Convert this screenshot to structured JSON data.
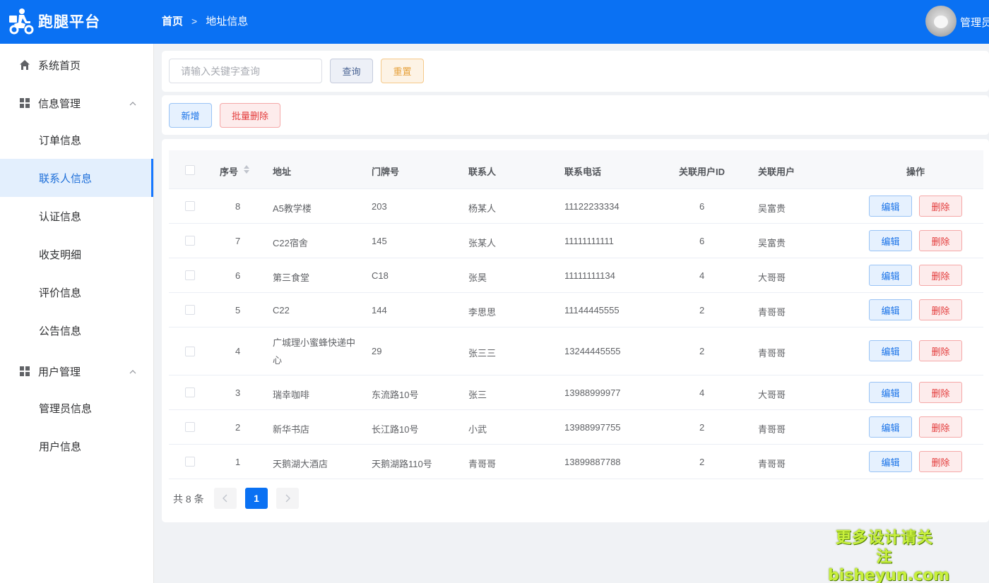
{
  "header": {
    "app_title": "跑腿平台",
    "breadcrumb_home": "首页",
    "breadcrumb_current": "地址信息",
    "user_name": "管理员",
    "color": "#0a71f3"
  },
  "sidebar": {
    "items": [
      {
        "label": "系统首页",
        "icon": "home-icon"
      },
      {
        "label": "信息管理",
        "icon": "grid-icon",
        "expanded": true
      },
      {
        "label": "订单信息"
      },
      {
        "label": "联系人信息",
        "active": true
      },
      {
        "label": "认证信息"
      },
      {
        "label": "收支明细"
      },
      {
        "label": "评价信息"
      },
      {
        "label": "公告信息"
      },
      {
        "label": "用户管理",
        "icon": "grid-icon",
        "expanded": true
      },
      {
        "label": "管理员信息"
      },
      {
        "label": "用户信息"
      }
    ]
  },
  "search": {
    "placeholder": "请输入关键字查询",
    "query_label": "查询",
    "reset_label": "重置"
  },
  "toolbar": {
    "add_label": "新增",
    "batch_delete_label": "批量删除"
  },
  "table": {
    "columns": [
      "序号",
      "地址",
      "门牌号",
      "联系人",
      "联系电话",
      "关联用户ID",
      "关联用户",
      "操作"
    ],
    "edit_label": "编辑",
    "delete_label": "删除",
    "rows": [
      {
        "id": "8",
        "address": "A5教学楼",
        "door": "203",
        "contact": "杨某人",
        "phone": "11122233334",
        "user_id": "6",
        "user": "吴富贵"
      },
      {
        "id": "7",
        "address": "C22宿舍",
        "door": "145",
        "contact": "张某人",
        "phone": "11111111111",
        "user_id": "6",
        "user": "吴富贵"
      },
      {
        "id": "6",
        "address": "第三食堂",
        "door": "C18",
        "contact": "张昊",
        "phone": "11111111134",
        "user_id": "4",
        "user": "大哥哥"
      },
      {
        "id": "5",
        "address": "C22",
        "door": "144",
        "contact": "李思思",
        "phone": "11144445555",
        "user_id": "2",
        "user": "青哥哥"
      },
      {
        "id": "4",
        "address": "广城理小蜜蜂快递中心",
        "door": "29",
        "contact": "张三三",
        "phone": "13244445555",
        "user_id": "2",
        "user": "青哥哥"
      },
      {
        "id": "3",
        "address": "瑞幸咖啡",
        "door": "东流路10号",
        "contact": "张三",
        "phone": "13988999977",
        "user_id": "4",
        "user": "大哥哥"
      },
      {
        "id": "2",
        "address": "新华书店",
        "door": "长江路10号",
        "contact": "小武",
        "phone": "13988997755",
        "user_id": "2",
        "user": "青哥哥"
      },
      {
        "id": "1",
        "address": "天鹅湖大酒店",
        "door": "天鹅湖路110号",
        "contact": "青哥哥",
        "phone": "13899887788",
        "user_id": "2",
        "user": "青哥哥"
      }
    ]
  },
  "pagination": {
    "total_text": "共 8 条",
    "current_page": "1",
    "prev_icon": "chevron-left-icon",
    "next_icon": "chevron-right-icon"
  },
  "watermark": {
    "line1": "更多设计请关注",
    "line2": "bisheyun.com"
  }
}
